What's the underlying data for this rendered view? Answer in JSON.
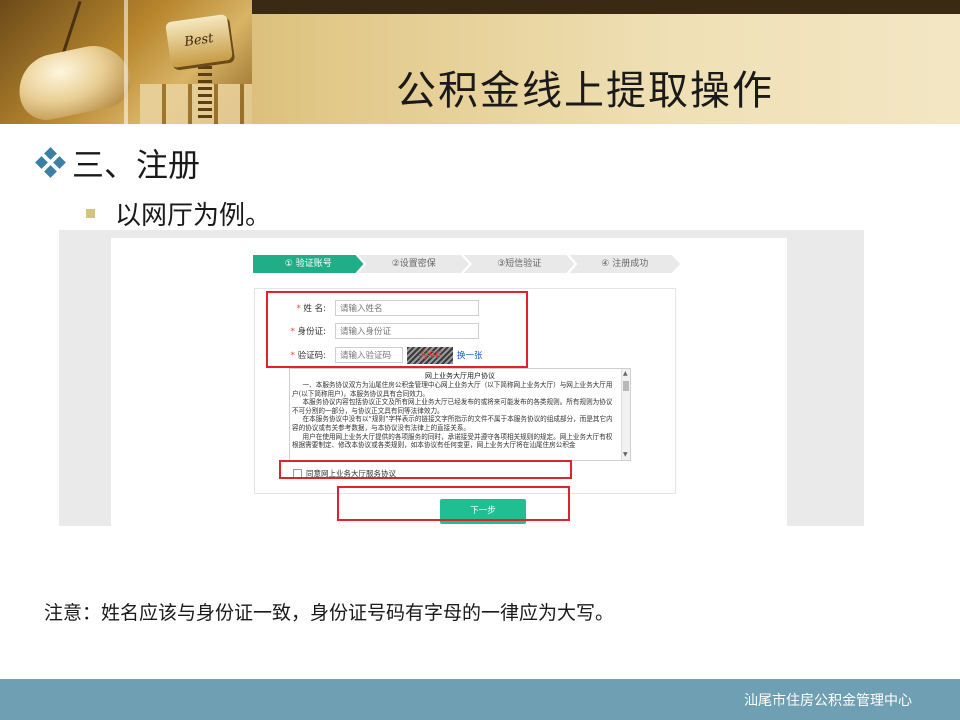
{
  "slide": {
    "title": "公积金线上提取操作",
    "key_text": "Best",
    "bullet_l1": "三、注册",
    "bullet_l2": "以网厅为例。",
    "note": "注意：姓名应该与身份证一致，身份证号码有字母的一律应为大写。",
    "footer": "汕尾市住房公积金管理中心"
  },
  "screenshot": {
    "steps": [
      {
        "label": "① 验证账号",
        "active": true
      },
      {
        "label": "②设置密保",
        "active": false
      },
      {
        "label": "③短信验证",
        "active": false
      },
      {
        "label": "④ 注册成功",
        "active": false
      }
    ],
    "form": {
      "required_mark": "*",
      "name_label": "姓  名:",
      "name_placeholder": "请输入姓名",
      "id_label": "身份证:",
      "id_placeholder": "请输入身份证",
      "captcha_label": "验证码:",
      "captcha_placeholder": "请输入验证码",
      "captcha_text": "分96",
      "refresh_label": "换一张"
    },
    "agreement": {
      "title": "网上业务大厅用户协议",
      "paragraphs": [
        "一、本服务协议双方为汕尾住房公积金管理中心网上业务大厅（以下简称网上业务大厅）与网上业务大厅用户(以下简称用户)，本服务协议具有合同效力。",
        "本服务协议内容包括协议正文及所有网上业务大厅已经发布的或将来可能发布的各类规则。所有规则为协议不可分割的一部分，与协议正文具有同等法律效力。",
        "在本服务协议中没有以“规则”字样表示的链接文字所指示的文件不属于本服务协议的组成部分，而是其它内容的协议或有关参考数据，与本协议没有法律上的直接关系。",
        "用户在使用网上业务大厅提供的各项服务的同时，承诺接受并遵守各项相关规则的规定。网上业务大厅有权根据需要制定、修改本协议或各类规则，如本协议有任何变更，网上业务大厅将在汕尾住房公积金"
      ],
      "scroll_up": "▲",
      "scroll_down": "▼"
    },
    "agree_label": "同意网上业务大厅服务协议",
    "next_button": "下一步"
  },
  "colors": {
    "accent_green": "#1fae88",
    "highlight_red": "#e0232b",
    "footer_blue": "#6e9fb3",
    "bullet_blue": "#3a7fa4"
  }
}
